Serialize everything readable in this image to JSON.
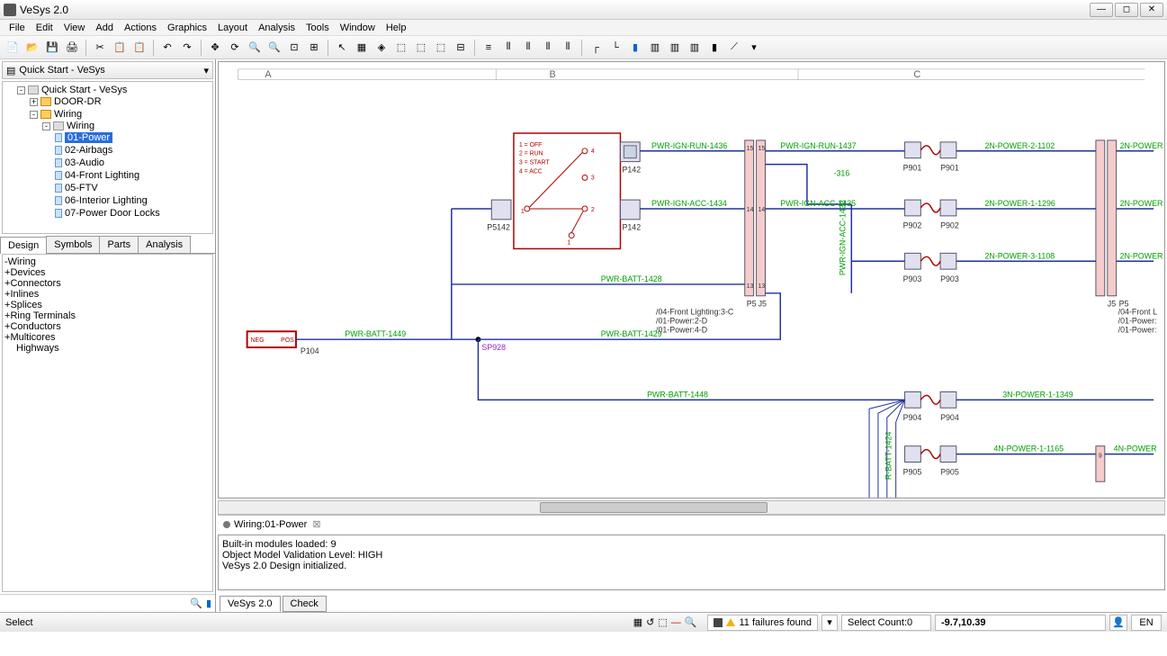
{
  "app": {
    "title": "VeSys 2.0"
  },
  "menu": [
    "File",
    "Edit",
    "View",
    "Add",
    "Actions",
    "Graphics",
    "Layout",
    "Analysis",
    "Tools",
    "Window",
    "Help"
  ],
  "quickstart": {
    "label": "Quick Start - VeSys"
  },
  "projectTree": {
    "root": "Quick Start - VeSys",
    "door": "DOOR-DR",
    "wiring": "Wiring",
    "wiring2": "Wiring",
    "items": [
      "01-Power",
      "02-Airbags",
      "03-Audio",
      "04-Front Lighting",
      "05-FTV",
      "06-Interior Lighting",
      "07-Power Door Locks"
    ]
  },
  "leftTabs": [
    "Design",
    "Symbols",
    "Parts",
    "Analysis"
  ],
  "designTree": {
    "root": "Wiring",
    "items": [
      "Devices",
      "Connectors",
      "Inlines",
      "Splices",
      "Ring Terminals",
      "Conductors",
      "Multicores",
      "Highways"
    ]
  },
  "docTab": {
    "label": "Wiring:01-Power"
  },
  "console": {
    "l1": "Built-in modules loaded: 9",
    "l2": "Object Model Validation Level: HIGH",
    "l3": "VeSys 2.0 Design initialized."
  },
  "consoleTabs": [
    "VeSys 2.0",
    "Check"
  ],
  "status": {
    "left": "Select",
    "failures": "11 failures found",
    "selectCount": "Select Count:0",
    "coords": "-9.7,10.39",
    "lang": "EN"
  },
  "diagram": {
    "cols": [
      "A",
      "B",
      "C"
    ],
    "switch": {
      "l1": "1 = OFF",
      "l2": "2 = RUN",
      "l3": "3 = START",
      "l4": "4 = ACC"
    },
    "wires": {
      "ignRun1": "PWR-IGN-RUN-1436",
      "ignRun2": "PWR-IGN-RUN-1437",
      "neg316": "-316",
      "ignAcc1": "PWR-IGN-ACC-1434",
      "ignAcc2": "PWR-IGN-ACC-1435",
      "ignAccV": "PWR-IGN-ACC-1433",
      "batt1428": "PWR-BATT-1428",
      "batt1449": "PWR-BATT-1449",
      "batt1429": "PWR-BATT-1429",
      "batt1448": "PWR-BATT-1448",
      "n2p2": "2N-POWER-2-1102",
      "n2p1": "2N-POWER-1-1296",
      "n2p3": "2N-POWER-3-1108",
      "n3p1": "3N-POWER-1-1349",
      "n4p1": "4N-POWER-1-1165",
      "n2p": "2N-POWER",
      "n4p": "4N-POWER",
      "battV": "R-BATT-1424"
    },
    "refs": {
      "r1": "/04-Front Lighting:3-C",
      "r2": "/01-Power:2-D",
      "r3": "/01-Power:4-D",
      "r4": "/04-Front L",
      "r5": "/01-Power:",
      "r6": "/01-Power:"
    },
    "comp": {
      "p142": "P142",
      "p5142": "P5142",
      "p104": "P104",
      "sp928": "SP928",
      "p5": "P5",
      "j5": "J5",
      "p901": "P901",
      "p902": "P902",
      "p903": "P903",
      "p904": "P904",
      "p905": "P905",
      "pin15": "15",
      "pin14": "14",
      "pin13": "13",
      "pin1": "1",
      "pin2": "2",
      "pin3": "3",
      "pin4": "4",
      "pin9": "9"
    }
  }
}
